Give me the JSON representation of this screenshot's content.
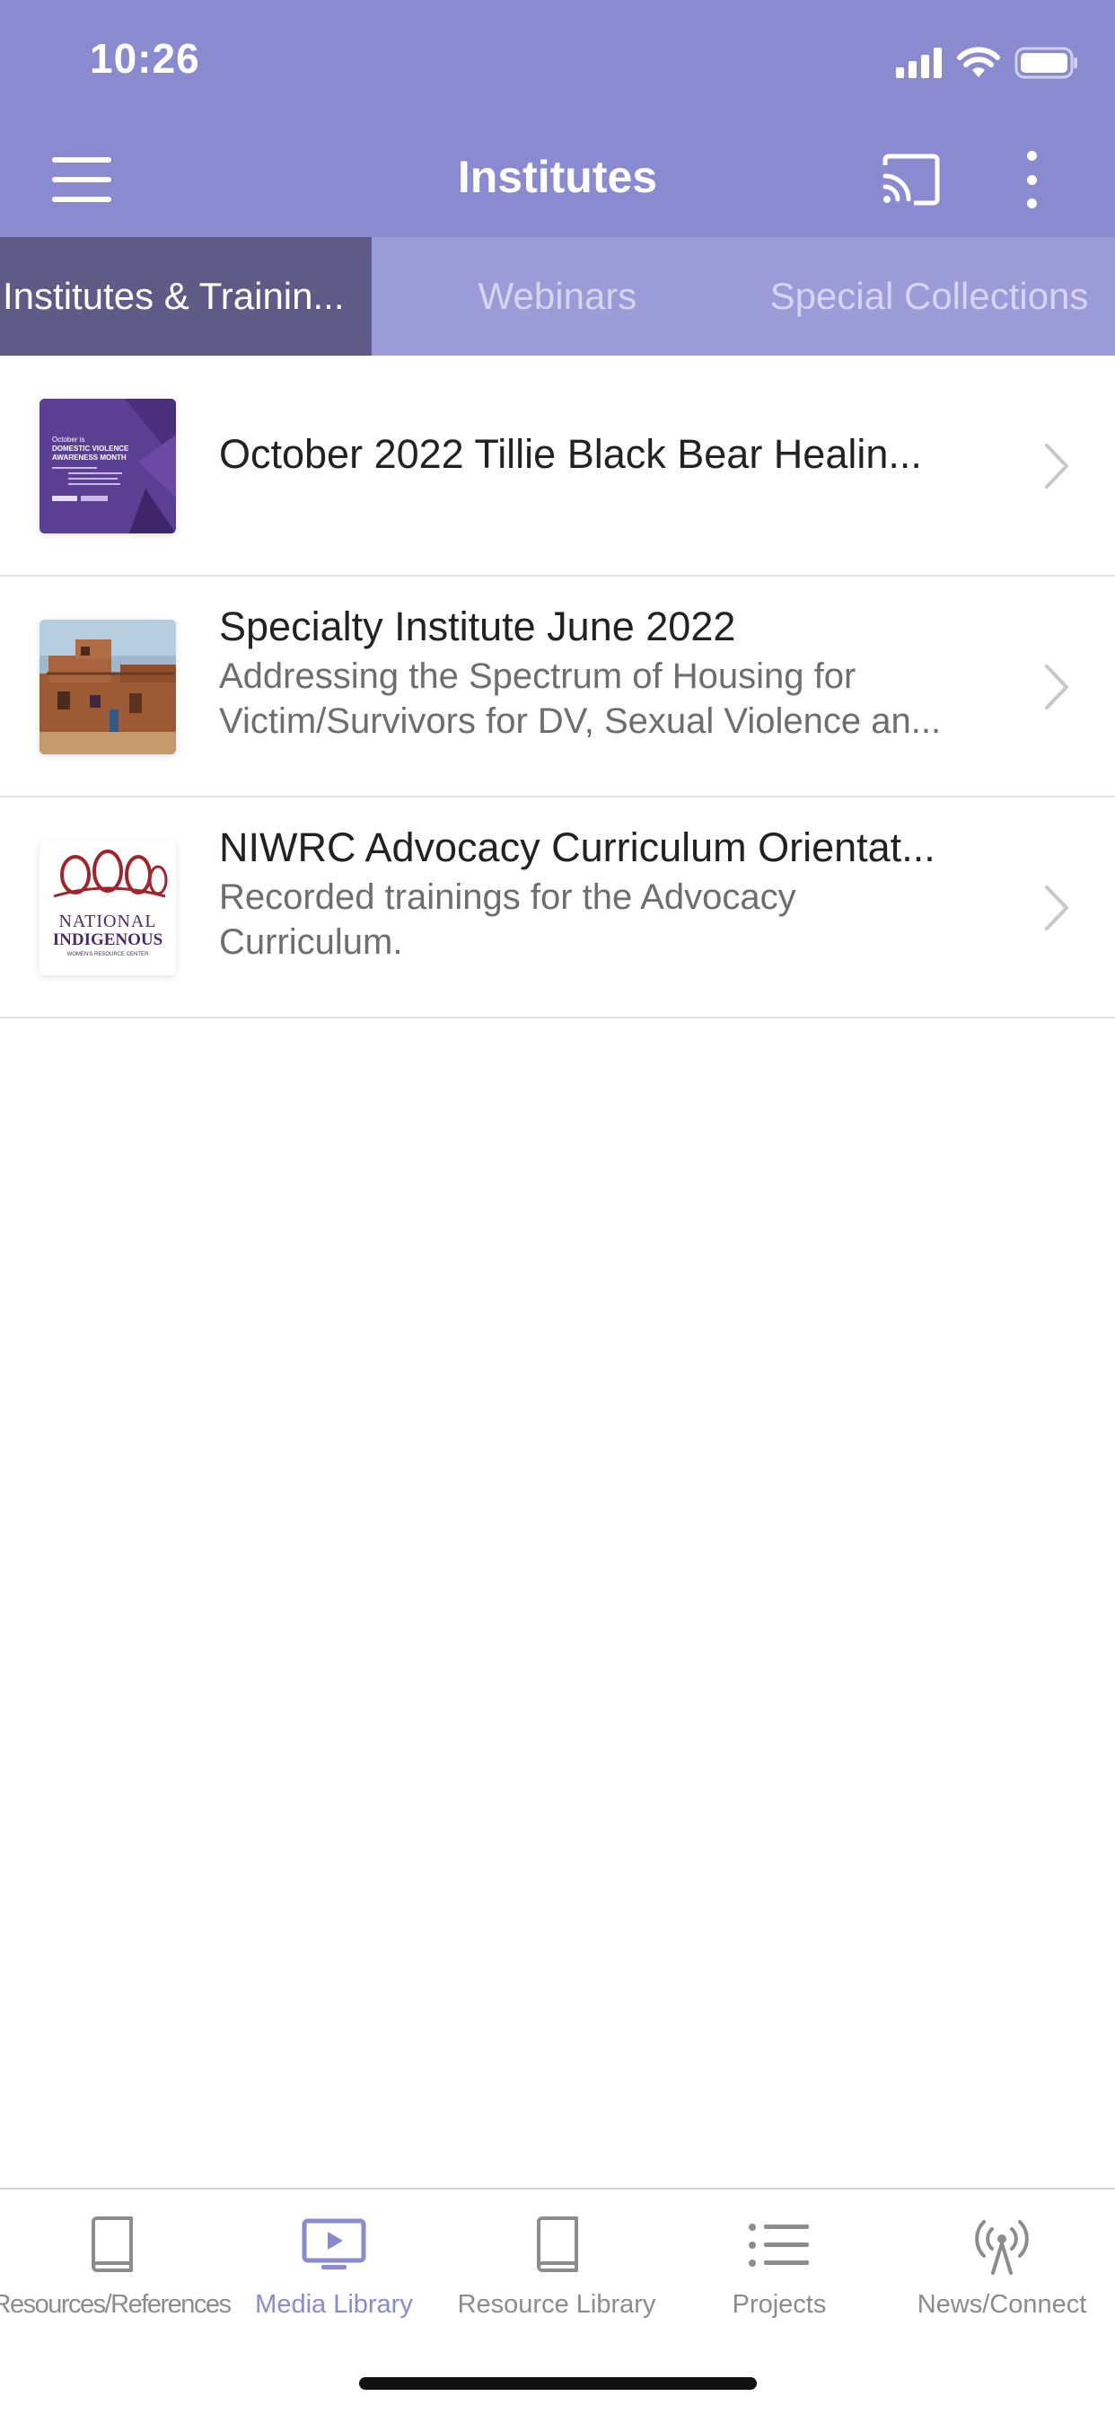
{
  "status_bar": {
    "time": "10:26"
  },
  "nav": {
    "title": "Institutes"
  },
  "tabs": [
    {
      "label": "Institutes & Trainin...",
      "active": true
    },
    {
      "label": "Webinars",
      "active": false
    },
    {
      "label": "Special Collections",
      "active": false
    }
  ],
  "items": [
    {
      "title": "October 2022 Tillie Black Bear Healin...",
      "subtitle_lines": [],
      "thumb": {
        "line1": "October is",
        "line2": "DOMESTIC VIOLENCE",
        "line3": "AWARENESS MONTH"
      }
    },
    {
      "title": "Specialty Institute June 2022",
      "subtitle_lines": [
        "Addressing the Spectrum of Housing for",
        "Victim/Survivors for DV, Sexual Violence an..."
      ]
    },
    {
      "title": "NIWRC Advocacy Curriculum Orientat...",
      "subtitle_lines": [
        "Recorded trainings for the Advocacy",
        "Curriculum."
      ],
      "thumb": {
        "line1": "NATIONAL",
        "line2": "INDIGENOUS",
        "line3": "WOMEN'S RESOURCE CENTER"
      }
    }
  ],
  "tabbar": [
    {
      "label": "Resources/References",
      "icon": "book-icon",
      "active": false
    },
    {
      "label": "Media Library",
      "icon": "tv-play-icon",
      "active": true
    },
    {
      "label": "Resource Library",
      "icon": "book-icon",
      "active": false
    },
    {
      "label": "Projects",
      "icon": "list-icon",
      "active": false
    },
    {
      "label": "News/Connect",
      "icon": "broadcast-icon",
      "active": false
    }
  ],
  "colors": {
    "header": "#8a8ad0",
    "tab_strip": "#9b9bd8",
    "tab_active": "#5f5b86",
    "accent": "#8a8ad0",
    "inactive_icon": "#8c8c8c"
  }
}
